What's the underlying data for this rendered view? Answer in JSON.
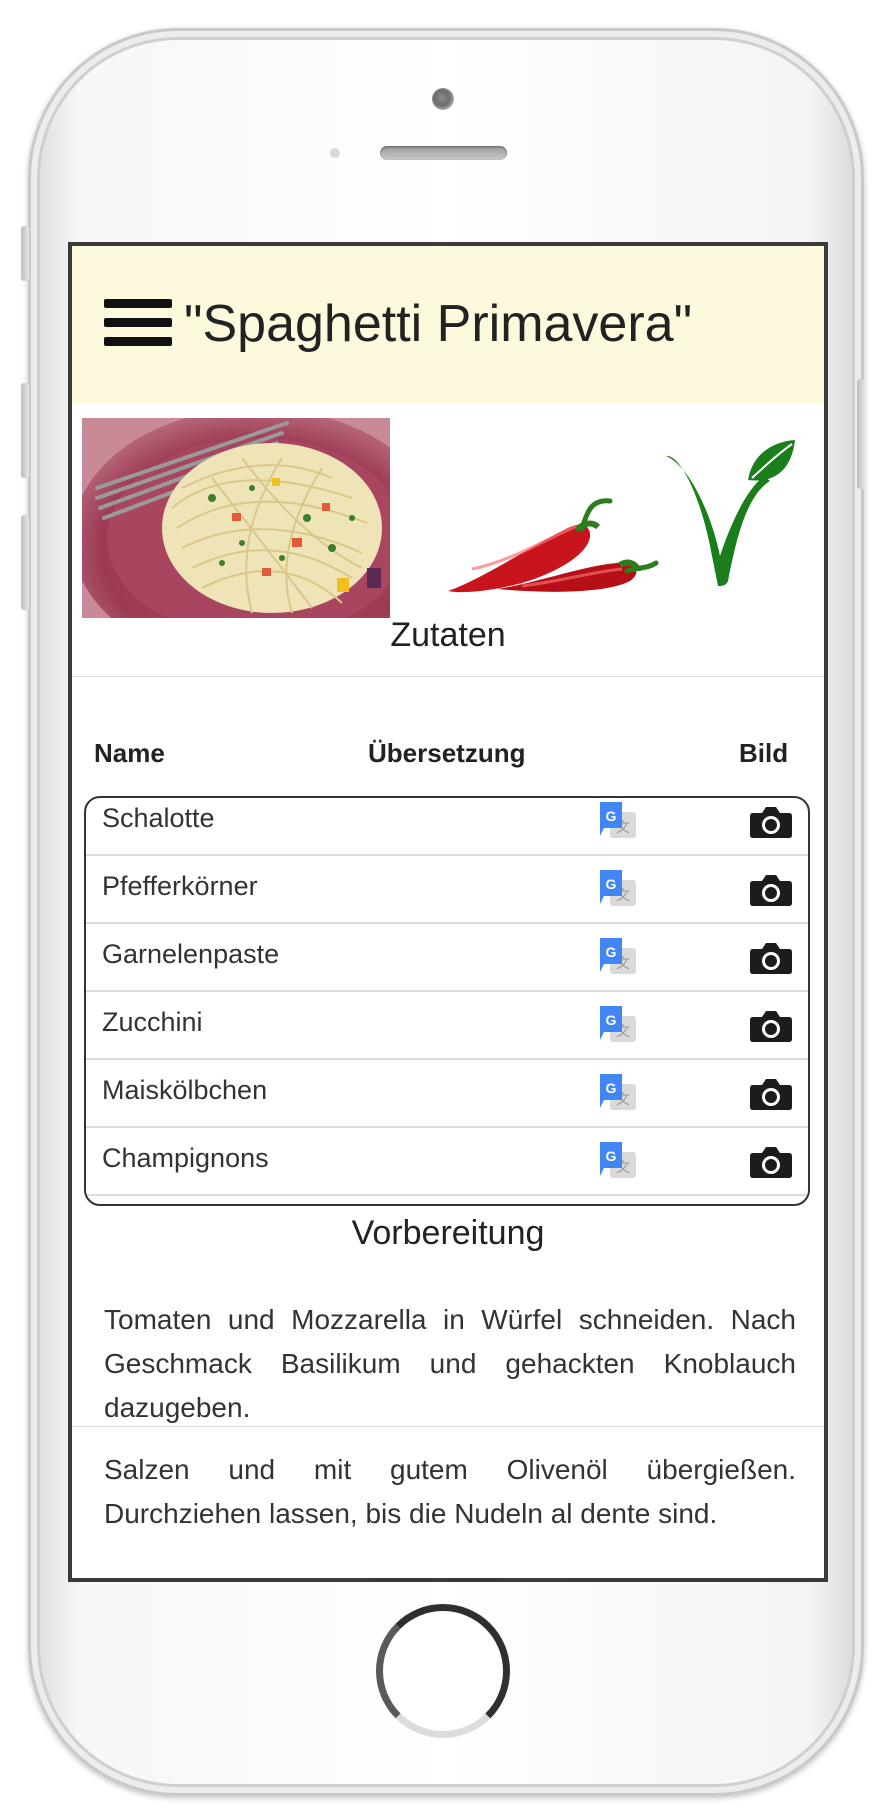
{
  "header": {
    "title": "\"Spaghetti Primavera\""
  },
  "icons": {
    "menu": "menu-icon",
    "spicy": "chili-pepper-icon",
    "vegan": "vegan-v-icon",
    "translate": "google-translate-icon",
    "photo": "camera-icon"
  },
  "colors": {
    "header_bg": "#fdf9dc",
    "chili_red": "#c8141c",
    "vegan_green": "#1a7f1a",
    "translate_blue": "#4285f4"
  },
  "ingredients": {
    "heading": "Zutaten",
    "columns": {
      "name": "Name",
      "translation": "Übersetzung",
      "image": "Bild"
    },
    "items": [
      "Schalotte",
      "Pfefferkörner",
      "Garnelenpaste",
      "Zucchini",
      "Maiskölbchen",
      "Champignons"
    ]
  },
  "preparation": {
    "heading": "Vorbereitung",
    "steps": [
      "Tomaten und Mozzarella in Würfel schneiden. Nach Geschmack Basilikum und gehackten Knoblauch dazugeben.",
      "Salzen und mit gutem Olivenöl übergießen. Durchziehen lassen, bis die Nudeln al dente sind."
    ]
  }
}
